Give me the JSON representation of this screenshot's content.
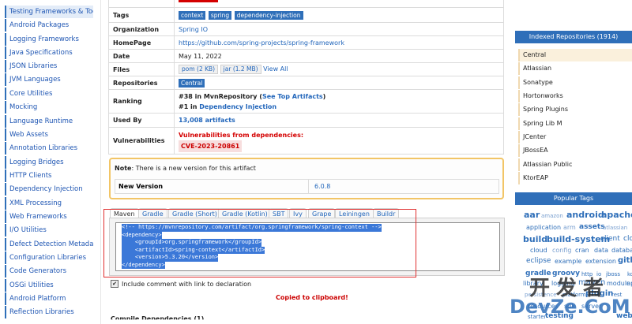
{
  "sidebar": {
    "items": [
      {
        "label": "Testing Frameworks & Tools",
        "selected": true
      },
      {
        "label": "Android Packages"
      },
      {
        "label": "Logging Frameworks"
      },
      {
        "label": "Java Specifications"
      },
      {
        "label": "JSON Libraries"
      },
      {
        "label": "JVM Languages"
      },
      {
        "label": "Core Utilities"
      },
      {
        "label": "Mocking"
      },
      {
        "label": "Language Runtime"
      },
      {
        "label": "Web Assets"
      },
      {
        "label": "Annotation Libraries"
      },
      {
        "label": "Logging Bridges"
      },
      {
        "label": "HTTP Clients"
      },
      {
        "label": "Dependency Injection"
      },
      {
        "label": "XML Processing"
      },
      {
        "label": "Web Frameworks"
      },
      {
        "label": "I/O Utilities"
      },
      {
        "label": "Defect Detection Metadata"
      },
      {
        "label": "Configuration Libraries"
      },
      {
        "label": "Code Generators"
      },
      {
        "label": "OSGi Utilities"
      },
      {
        "label": "Android Platform"
      },
      {
        "label": "Reflection Libraries"
      }
    ]
  },
  "info": {
    "tags": {
      "key": "Tags",
      "values": [
        "context",
        "spring",
        "dependency-injection"
      ]
    },
    "organization": {
      "key": "Organization",
      "value": "Spring IO"
    },
    "homepage": {
      "key": "HomePage",
      "value": "https://github.com/spring-projects/spring-framework"
    },
    "date": {
      "key": "Date",
      "value": "May 11, 2022"
    },
    "files": {
      "key": "Files",
      "pom": "pom (2 KB)",
      "jar": "jar (1.2 MB)",
      "view_all": "View All"
    },
    "repositories": {
      "key": "Repositories",
      "value": "Central"
    },
    "ranking": {
      "key": "Ranking",
      "line1_prefix": "#38 in MvnRepository (",
      "line1_link": "See Top Artifacts",
      "line1_suffix": ")",
      "line2_prefix": "#1 in ",
      "line2_link": "Dependency Injection"
    },
    "used_by": {
      "key": "Used By",
      "value": "13,008 artifacts"
    },
    "vulnerabilities": {
      "key": "Vulnerabilities",
      "label": "Vulnerabilities from dependencies:",
      "cve": "CVE-2023-20861"
    }
  },
  "notice": {
    "prefix": "Note",
    "text": ": There is a new version for this artifact",
    "new_version_label": "New Version",
    "new_version_value": "6.0.8"
  },
  "build_tabs": [
    "Maven",
    "Gradle",
    "Gradle (Short)",
    "Gradle (Kotlin)",
    "SBT",
    "Ivy",
    "Grape",
    "Leiningen",
    "Buildr"
  ],
  "code_lines": [
    "<!-- https://mvnrepository.com/artifact/org.springframework/spring-context -->",
    "<dependency>",
    "    <groupId>org.springframework</groupId>",
    "    <artifactId>spring-context</artifactId>",
    "    <version>5.3.20</version>",
    "</dependency>"
  ],
  "include_comment": {
    "label": "Include comment with link to declaration",
    "checked": true
  },
  "copied_text": "Copied to clipboard!",
  "partial_heading": "Compile Dependencies (1)",
  "indexed_repositories": {
    "title": "Indexed Repositories (1914)",
    "items": [
      "Central",
      "Atlassian",
      "Sonatype",
      "Hortonworks",
      "Spring Plugins",
      "Spring Lib M",
      "JCenter",
      "JBossEA",
      "Atlassian Public",
      "KtorEAP"
    ]
  },
  "popular_tags": {
    "title": "Popular Tags",
    "words": [
      "aar",
      "amazon",
      "android",
      "apache",
      "application",
      "arm",
      "assets",
      "atlassian",
      "build",
      "build-system",
      "client",
      "clo",
      "cloud",
      "config",
      "cran",
      "data",
      "databa",
      "eclipse",
      "example",
      "extension",
      "gith",
      "gradle",
      "groovy",
      "http",
      "io",
      "jboss",
      "ko",
      "library",
      "logging",
      "maven",
      "module",
      "npm",
      "persistence",
      "platform",
      "plugin",
      "rest",
      "resources",
      "sdk",
      "server",
      "starter",
      "testing",
      "web"
    ]
  },
  "watermark": {
    "line1": "开发者",
    "line2": "DevZe.CoM"
  },
  "colors": {
    "link": "#2266bb",
    "primary": "#2f6fb9",
    "alert": "#d40000",
    "notice_border": "#f2c566",
    "highlight": "#3b78d8"
  }
}
